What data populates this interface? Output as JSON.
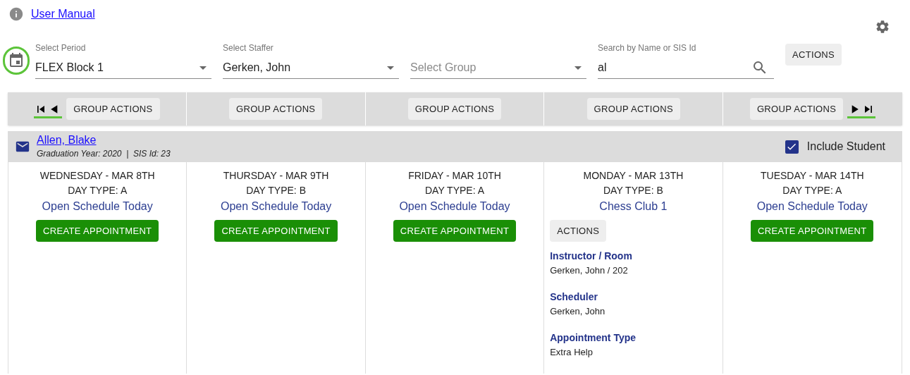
{
  "manual_link": "User Manual",
  "filters": [
    {
      "kind": "select",
      "label": "Select Period",
      "value": "FLEX Block 1"
    },
    {
      "kind": "select",
      "label": "Select Staffer",
      "value": "Gerken, John"
    },
    {
      "kind": "select",
      "placeholder": "Select Group"
    },
    {
      "kind": "search",
      "label": "Search by Name or SIS Id",
      "value": "al"
    }
  ],
  "actions_button": "ACTIONS",
  "group_actions": [
    "GROUP ACTIONS",
    "GROUP ACTIONS",
    "GROUP ACTIONS",
    "GROUP ACTIONS",
    "GROUP ACTIONS"
  ],
  "student": {
    "name": "Allen, Blake",
    "meta": "Graduation Year: 2020  |  SIS Id: 23",
    "include_label": "Include Student",
    "included": true
  },
  "days": [
    {
      "kind": "open",
      "date": "WEDNESDAY - MAR 8TH",
      "day_type": "DAY TYPE: A",
      "schedule": "Open Schedule Today",
      "button": "CREATE APPOINTMENT"
    },
    {
      "kind": "open",
      "date": "THURSDAY - MAR 9TH",
      "day_type": "DAY TYPE: B",
      "schedule": "Open Schedule Today",
      "button": "CREATE APPOINTMENT"
    },
    {
      "kind": "open",
      "date": "FRIDAY - MAR 10TH",
      "day_type": "DAY TYPE: A",
      "schedule": "Open Schedule Today",
      "button": "CREATE APPOINTMENT"
    },
    {
      "kind": "appointment",
      "date": "MONDAY - MAR 13TH",
      "day_type": "DAY TYPE: B",
      "schedule": "Chess Club 1",
      "button": "ACTIONS",
      "details": [
        {
          "label": "Instructor / Room",
          "value": "Gerken, John / 202"
        },
        {
          "label": "Scheduler",
          "value": "Gerken, John"
        },
        {
          "label": "Appointment Type",
          "value": "Extra Help"
        }
      ]
    },
    {
      "kind": "open",
      "date": "TUESDAY - MAR 14TH",
      "day_type": "DAY TYPE: A",
      "schedule": "Open Schedule Today",
      "button": "CREATE APPOINTMENT"
    }
  ]
}
